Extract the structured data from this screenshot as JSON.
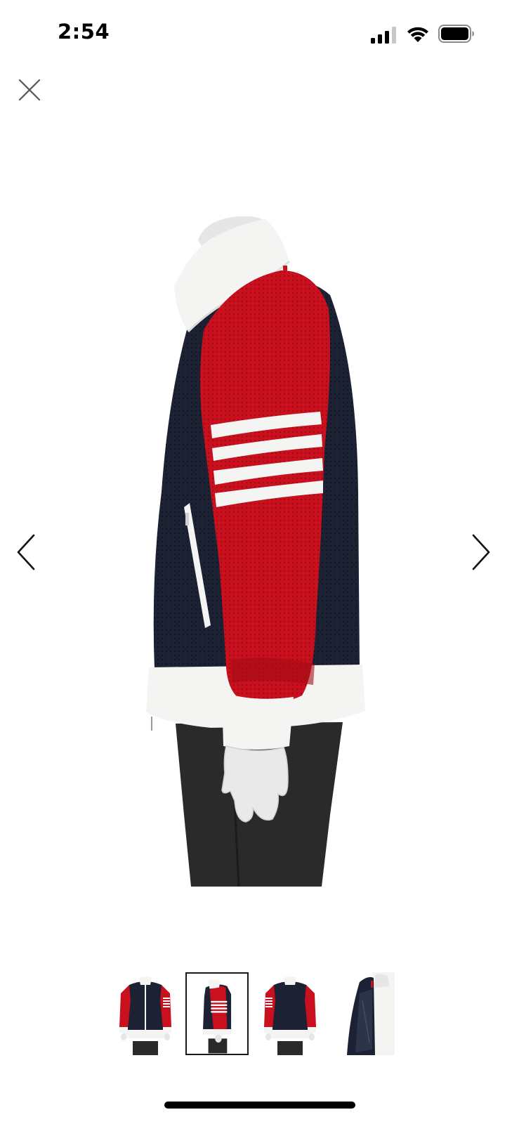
{
  "status_bar": {
    "time": "2:54",
    "signal_icon": "cellular-signal-icon",
    "wifi_icon": "wifi-icon",
    "battery_icon": "battery-icon"
  },
  "viewer": {
    "close_icon": "close-icon",
    "prev_icon": "chevron-left-icon",
    "next_icon": "chevron-right-icon",
    "current_index": 2,
    "image_count": 4,
    "main_image": "jacket-side-view"
  },
  "thumbnails": [
    {
      "view": "front",
      "selected": false
    },
    {
      "view": "side",
      "selected": true
    },
    {
      "view": "back",
      "selected": false
    },
    {
      "view": "interior",
      "selected": false
    }
  ],
  "colors": {
    "navy": "#1c2233",
    "red": "#c8101e",
    "white_rib": "#f4f4f2",
    "pants": "#2a2a2a"
  }
}
